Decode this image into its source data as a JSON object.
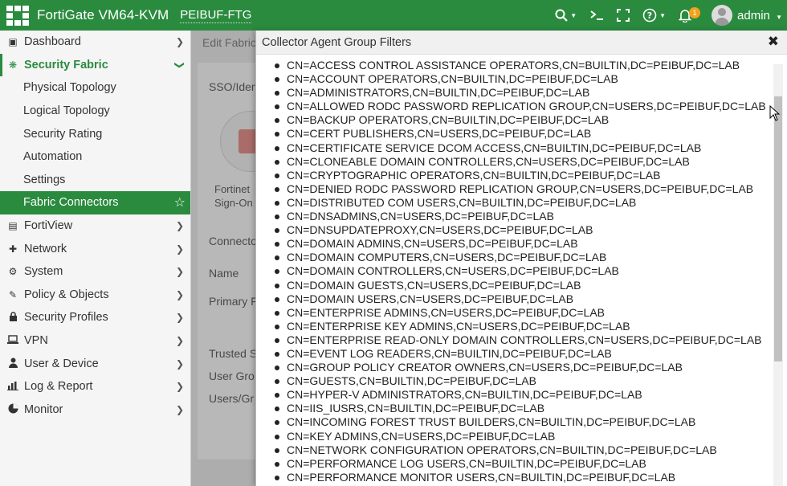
{
  "topbar": {
    "product": "FortiGate VM64-KVM",
    "hostname": "PEIBUF-FTG",
    "notification_count": "1",
    "user": "admin",
    "icons": [
      "search-icon",
      "terminal-icon",
      "fullscreen-icon",
      "help-icon",
      "bell-icon"
    ]
  },
  "sidebar": {
    "items": [
      {
        "label": "Dashboard",
        "icon": "dashboard-icon"
      },
      {
        "label": "Security Fabric",
        "icon": "security-fabric-icon"
      },
      {
        "label": "Physical Topology"
      },
      {
        "label": "Logical Topology"
      },
      {
        "label": "Security Rating"
      },
      {
        "label": "Automation"
      },
      {
        "label": "Settings"
      },
      {
        "label": "Fabric Connectors"
      },
      {
        "label": "FortiView",
        "icon": "chart-icon"
      },
      {
        "label": "Network",
        "icon": "network-icon"
      },
      {
        "label": "System",
        "icon": "gear-icon"
      },
      {
        "label": "Policy & Objects",
        "icon": "policy-icon"
      },
      {
        "label": "Security Profiles",
        "icon": "lock-icon"
      },
      {
        "label": "VPN",
        "icon": "laptop-icon"
      },
      {
        "label": "User & Device",
        "icon": "user-icon"
      },
      {
        "label": "Log & Report",
        "icon": "bar-chart-icon"
      },
      {
        "label": "Monitor",
        "icon": "pie-chart-icon"
      }
    ]
  },
  "background": {
    "breadcrumb": "Edit Fabric",
    "section": "SSO/Iden",
    "connector_line1": "Fortinet",
    "connector_line2": "Sign-On",
    "connector_label": "Connecto",
    "name_label": "Name",
    "primary_label": "Primary F",
    "trusted_label": "Trusted S",
    "user_group_label": "User Gro",
    "users_label": "Users/Gr"
  },
  "panel": {
    "title": "Collector Agent Group Filters",
    "groups": [
      "CN=ACCESS CONTROL ASSISTANCE OPERATORS,CN=BUILTIN,DC=PEIBUF,DC=LAB",
      "CN=ACCOUNT OPERATORS,CN=BUILTIN,DC=PEIBUF,DC=LAB",
      "CN=ADMINISTRATORS,CN=BUILTIN,DC=PEIBUF,DC=LAB",
      "CN=ALLOWED RODC PASSWORD REPLICATION GROUP,CN=USERS,DC=PEIBUF,DC=LAB",
      "CN=BACKUP OPERATORS,CN=BUILTIN,DC=PEIBUF,DC=LAB",
      "CN=CERT PUBLISHERS,CN=USERS,DC=PEIBUF,DC=LAB",
      "CN=CERTIFICATE SERVICE DCOM ACCESS,CN=BUILTIN,DC=PEIBUF,DC=LAB",
      "CN=CLONEABLE DOMAIN CONTROLLERS,CN=USERS,DC=PEIBUF,DC=LAB",
      "CN=CRYPTOGRAPHIC OPERATORS,CN=BUILTIN,DC=PEIBUF,DC=LAB",
      "CN=DENIED RODC PASSWORD REPLICATION GROUP,CN=USERS,DC=PEIBUF,DC=LAB",
      "CN=DISTRIBUTED COM USERS,CN=BUILTIN,DC=PEIBUF,DC=LAB",
      "CN=DNSADMINS,CN=USERS,DC=PEIBUF,DC=LAB",
      "CN=DNSUPDATEPROXY,CN=USERS,DC=PEIBUF,DC=LAB",
      "CN=DOMAIN ADMINS,CN=USERS,DC=PEIBUF,DC=LAB",
      "CN=DOMAIN COMPUTERS,CN=USERS,DC=PEIBUF,DC=LAB",
      "CN=DOMAIN CONTROLLERS,CN=USERS,DC=PEIBUF,DC=LAB",
      "CN=DOMAIN GUESTS,CN=USERS,DC=PEIBUF,DC=LAB",
      "CN=DOMAIN USERS,CN=USERS,DC=PEIBUF,DC=LAB",
      "CN=ENTERPRISE ADMINS,CN=USERS,DC=PEIBUF,DC=LAB",
      "CN=ENTERPRISE KEY ADMINS,CN=USERS,DC=PEIBUF,DC=LAB",
      "CN=ENTERPRISE READ-ONLY DOMAIN CONTROLLERS,CN=USERS,DC=PEIBUF,DC=LAB",
      "CN=EVENT LOG READERS,CN=BUILTIN,DC=PEIBUF,DC=LAB",
      "CN=GROUP POLICY CREATOR OWNERS,CN=USERS,DC=PEIBUF,DC=LAB",
      "CN=GUESTS,CN=BUILTIN,DC=PEIBUF,DC=LAB",
      "CN=HYPER-V ADMINISTRATORS,CN=BUILTIN,DC=PEIBUF,DC=LAB",
      "CN=IIS_IUSRS,CN=BUILTIN,DC=PEIBUF,DC=LAB",
      "CN=INCOMING FOREST TRUST BUILDERS,CN=BUILTIN,DC=PEIBUF,DC=LAB",
      "CN=KEY ADMINS,CN=USERS,DC=PEIBUF,DC=LAB",
      "CN=NETWORK CONFIGURATION OPERATORS,CN=BUILTIN,DC=PEIBUF,DC=LAB",
      "CN=PERFORMANCE LOG USERS,CN=BUILTIN,DC=PEIBUF,DC=LAB",
      "CN=PERFORMANCE MONITOR USERS,CN=BUILTIN,DC=PEIBUF,DC=LAB"
    ]
  },
  "colors": {
    "brand_green": "#2a8b3f",
    "badge_orange": "#f2a21c"
  }
}
